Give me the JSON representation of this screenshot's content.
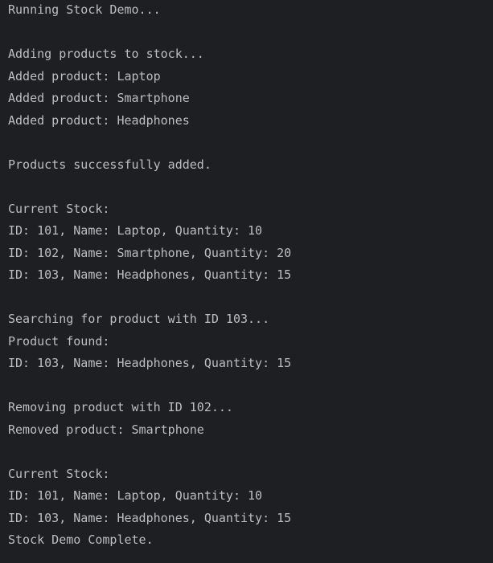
{
  "console": {
    "lines": [
      "Running Stock Demo...",
      "",
      "Adding products to stock...",
      "Added product: Laptop",
      "Added product: Smartphone",
      "Added product: Headphones",
      "",
      "Products successfully added.",
      "",
      "Current Stock:",
      "ID: 101, Name: Laptop, Quantity: 10",
      "ID: 102, Name: Smartphone, Quantity: 20",
      "ID: 103, Name: Headphones, Quantity: 15",
      "",
      "Searching for product with ID 103...",
      "Product found:",
      "ID: 103, Name: Headphones, Quantity: 15",
      "",
      "Removing product with ID 102...",
      "Removed product: Smartphone",
      "",
      "Current Stock:",
      "ID: 101, Name: Laptop, Quantity: 10",
      "ID: 103, Name: Headphones, Quantity: 15",
      "Stock Demo Complete."
    ]
  },
  "colors": {
    "background": "#1e1f22",
    "text": "#bcbec4"
  }
}
